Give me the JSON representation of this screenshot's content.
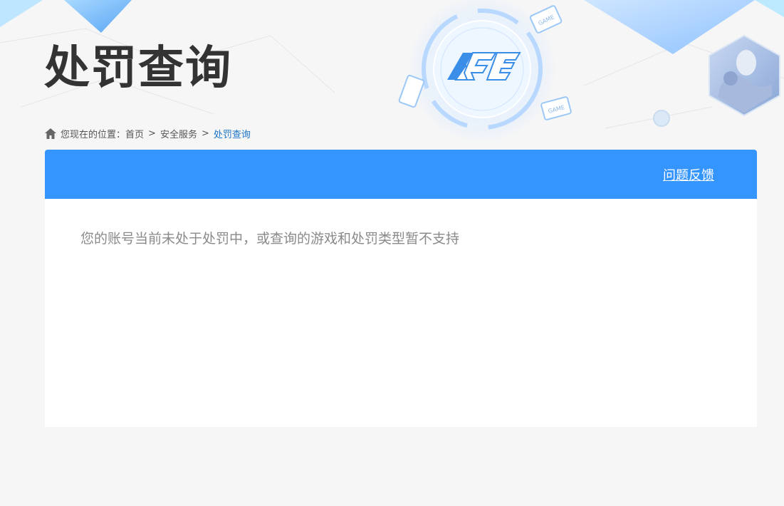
{
  "page": {
    "title": "处罚查询"
  },
  "breadcrumb": {
    "prefix": "您现在的位置：",
    "items": [
      "首页",
      "安全服务"
    ],
    "separator": ">",
    "current": "处罚查询"
  },
  "header": {
    "feedback_label": "问题反馈"
  },
  "main": {
    "message": "您的账号当前未处于处罚中，或查询的游戏和处罚类型暂不支持"
  },
  "decor": {
    "logo_text": "ACE",
    "badge_text": "GAME"
  },
  "colors": {
    "accent": "#3595ff",
    "link_current": "#1a73c8",
    "background": "#f6f6f6"
  }
}
